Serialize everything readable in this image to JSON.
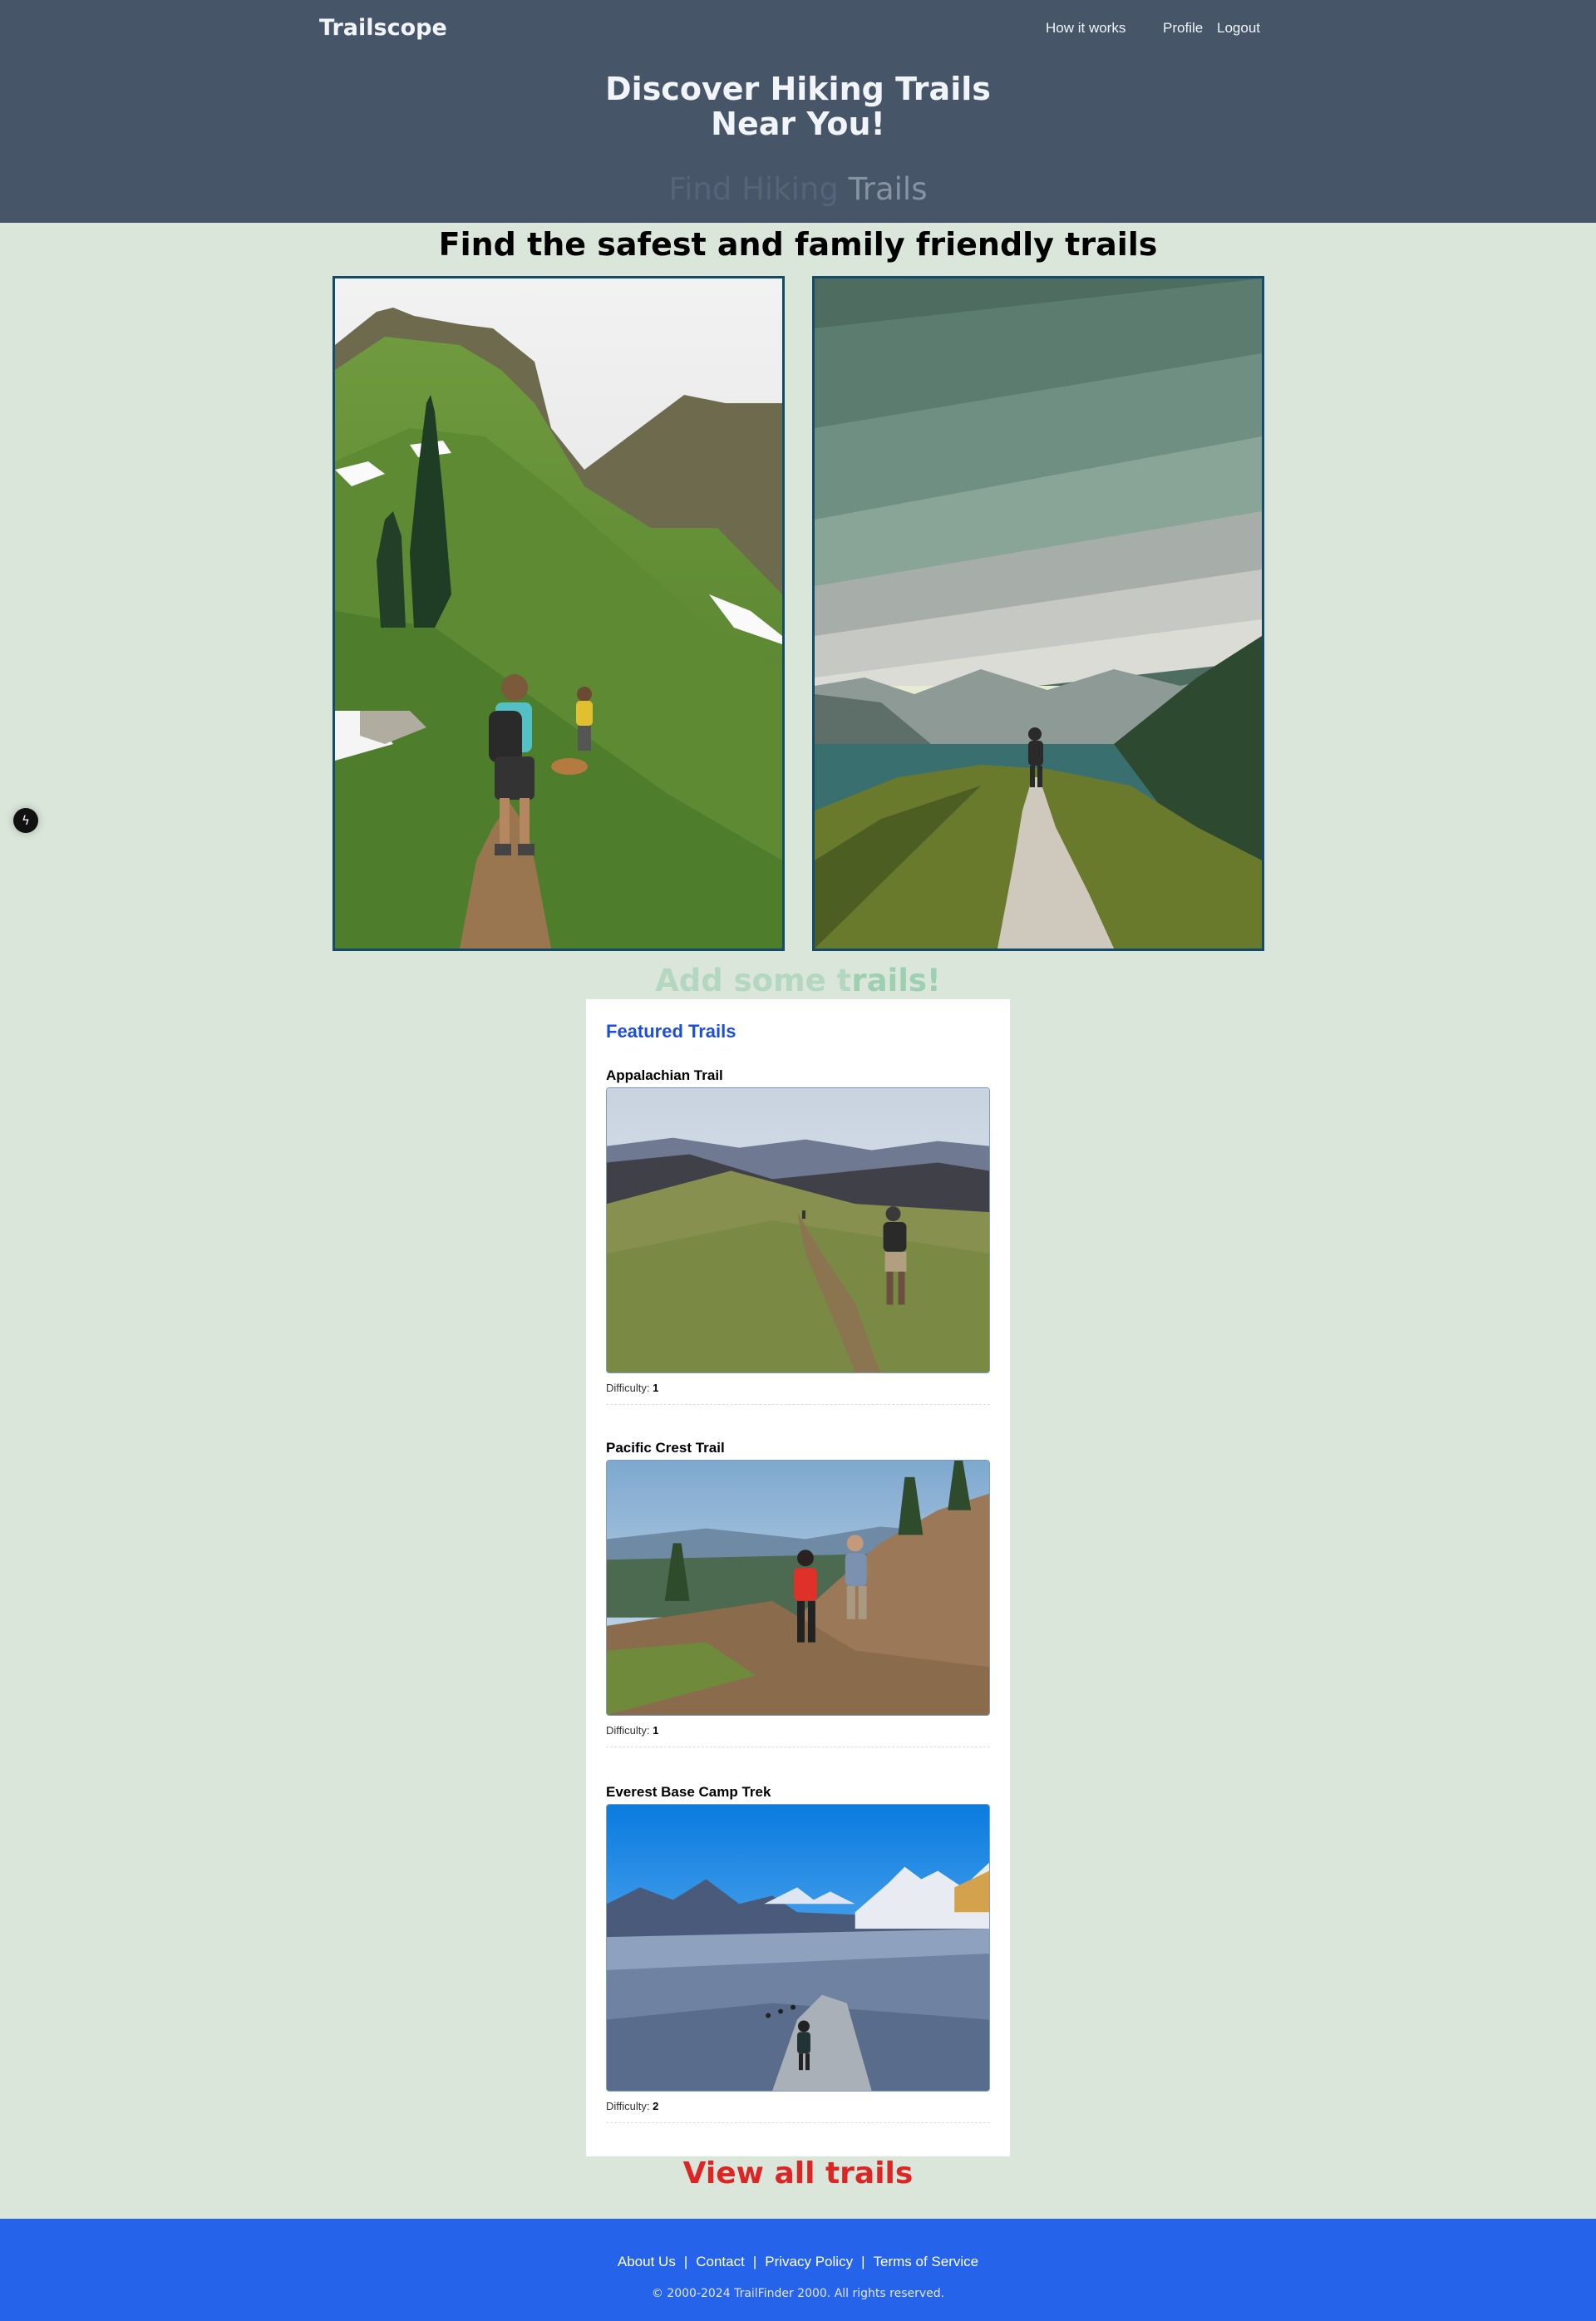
{
  "header": {
    "brand": "Trailscope",
    "nav": {
      "how_it_works": "How it works",
      "profile": "Profile",
      "logout": "Logout"
    },
    "hero_title_line1": "Discover Hiking Trails",
    "hero_title_line2": "Near You!",
    "hero_sub_faded": "Find Hiking ",
    "hero_sub_visible": "Trails"
  },
  "tagline": "Find the safest and family friendly trails",
  "add_trails": {
    "faded": "Add some t",
    "visible": "rails!"
  },
  "featured": {
    "title": "Featured Trails",
    "difficulty_label": "Difficulty:",
    "trails": [
      {
        "name": "Appalachian Trail",
        "difficulty": "1"
      },
      {
        "name": "Pacific Crest Trail",
        "difficulty": "1"
      },
      {
        "name": "Everest Base Camp Trek",
        "difficulty": "2"
      }
    ]
  },
  "view_all": "View all trails",
  "footer": {
    "links": [
      "About Us",
      "Contact",
      "Privacy Policy",
      "Terms of Service"
    ],
    "copyright": "© 2000-2024 TrailFinder 2000. All rights reserved."
  },
  "colors": {
    "header_bg": "#475569",
    "page_bg": "#d9e6d9",
    "featured_title": "#1d4ed8",
    "view_all": "#dc2626",
    "footer_bg": "#2563eb"
  }
}
